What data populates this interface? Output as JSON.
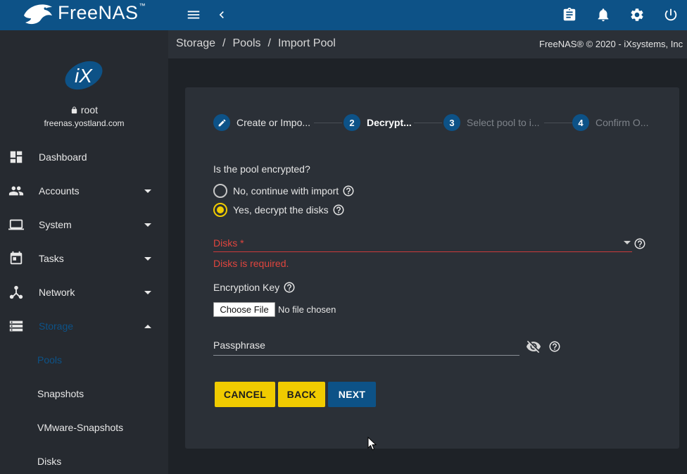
{
  "app": {
    "brand": "FreeNAS",
    "trademark": "™"
  },
  "topbar": {
    "icons": [
      "menu-icon",
      "back-chevron-icon",
      "clipboard-icon",
      "bell-icon",
      "gear-icon",
      "power-icon"
    ]
  },
  "sidebar": {
    "user": "root",
    "host": "freenas.yostland.com",
    "items": [
      {
        "label": "Dashboard",
        "icon": "dashboard-icon"
      },
      {
        "label": "Accounts",
        "icon": "accounts-icon"
      },
      {
        "label": "System",
        "icon": "laptop-icon"
      },
      {
        "label": "Tasks",
        "icon": "calendar-icon"
      },
      {
        "label": "Network",
        "icon": "network-icon"
      },
      {
        "label": "Storage",
        "icon": "storage-icon"
      }
    ],
    "storage_sub": [
      "Pools",
      "Snapshots",
      "VMware-Snapshots",
      "Disks"
    ]
  },
  "breadcrumb": {
    "items": [
      "Storage",
      "Pools",
      "Import Pool"
    ],
    "separator": "/"
  },
  "copyright": "FreeNAS® © 2020 - iXsystems, Inc",
  "wizard": {
    "steps": [
      {
        "marker": "",
        "label": "Create or Impo..."
      },
      {
        "marker": "2",
        "label": "Decrypt..."
      },
      {
        "marker": "3",
        "label": "Select pool to i..."
      },
      {
        "marker": "4",
        "label": "Confirm O..."
      }
    ],
    "question": "Is the pool encrypted?",
    "option_no": "No, continue with import",
    "option_yes": "Yes, decrypt the disks",
    "disks_label": "Disks *",
    "disks_error": "Disks is required.",
    "encryption_key_label": "Encryption Key",
    "choose_file": "Choose File",
    "file_status": "No file chosen",
    "passphrase_label": "Passphrase",
    "cancel": "CANCEL",
    "back": "BACK",
    "next": "NEXT"
  },
  "colors": {
    "brand_blue": "#0d5287",
    "accent_yellow": "#f0cb00",
    "error_red": "#e0453e"
  }
}
